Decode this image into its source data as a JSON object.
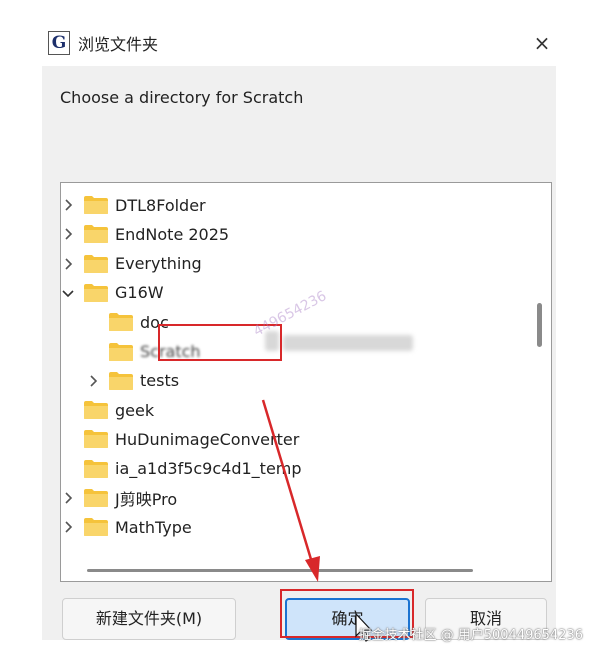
{
  "window": {
    "title": "浏览文件夹",
    "close": "×",
    "icon_letter": "G"
  },
  "prompt": "Choose a directory for Scratch",
  "tree": {
    "items": [
      {
        "label": "DTL8Folder",
        "expander": "collapsed",
        "indent": 0
      },
      {
        "label": "EndNote 2025",
        "expander": "collapsed",
        "indent": 0
      },
      {
        "label": "Everything",
        "expander": "collapsed",
        "indent": 0
      },
      {
        "label": "G16W",
        "expander": "expanded",
        "indent": 0
      },
      {
        "label": "doc",
        "expander": "none",
        "indent": 1
      },
      {
        "label": "Scratch",
        "expander": "none",
        "indent": 1,
        "selected": true
      },
      {
        "label": "tests",
        "expander": "collapsed",
        "indent": 1
      },
      {
        "label": "geek",
        "expander": "none",
        "indent": 0
      },
      {
        "label": "HuDunimageConverter",
        "expander": "none",
        "indent": 0
      },
      {
        "label": "ia_a1d3f5c9c4d1_temp",
        "expander": "none",
        "indent": 0
      },
      {
        "label": "J剪映Pro",
        "expander": "collapsed",
        "indent": 0
      },
      {
        "label": "MathType",
        "expander": "collapsed",
        "indent": 0
      }
    ]
  },
  "buttons": {
    "new_folder": "新建文件夹(M)",
    "ok": "确定",
    "cancel": "取消"
  },
  "watermark": "掘金技术社区 @ 用户500449654236",
  "watermark_diag": "449654236",
  "colors": {
    "folder": "#f5c33b",
    "accent": "#1b73d1",
    "annotation": "#d8282a"
  }
}
